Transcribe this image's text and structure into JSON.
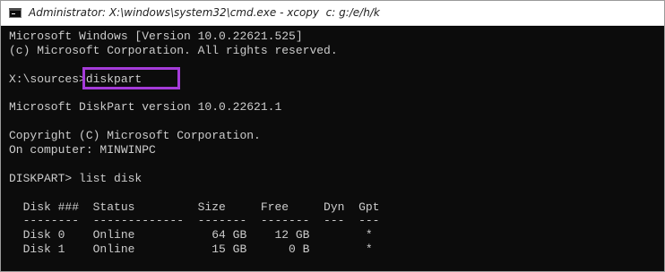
{
  "window": {
    "title": "Administrator: X:\\windows\\system32\\cmd.exe - xcopy  c: g:/e/h/k"
  },
  "console": {
    "lines": [
      "Microsoft Windows [Version 10.0.22621.525]",
      "(c) Microsoft Corporation. All rights reserved.",
      "",
      "X:\\sources>diskpart",
      "",
      "Microsoft DiskPart version 10.0.22621.1",
      "",
      "Copyright (C) Microsoft Corporation.",
      "On computer: MINWINPC",
      "",
      "DISKPART> list disk",
      "",
      "  Disk ###  Status         Size     Free     Dyn  Gpt",
      "  --------  -------------  -------  -------  ---  ---",
      "  Disk 0    Online           64 GB    12 GB        *",
      "  Disk 1    Online           15 GB      0 B        *"
    ]
  },
  "colors": {
    "console_bg": "#0c0c0c",
    "console_text": "#cccccc",
    "highlight": "#a43bd9"
  },
  "icons": {
    "app": "cmd-icon"
  }
}
